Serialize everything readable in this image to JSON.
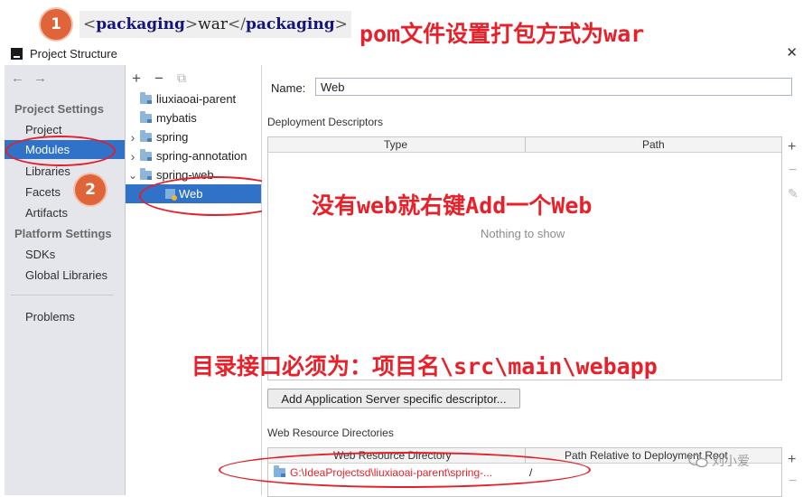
{
  "annotations": {
    "badge1": "1",
    "badge2": "2",
    "xml_open_tag": "packaging",
    "xml_value": "war",
    "xml_close_tag": "packaging",
    "note_pom": "pom文件设置打包方式为war",
    "note_add_web": "没有web就右键Add一个Web",
    "note_directory": "目录接口必须为：项目名\\src\\main\\webapp"
  },
  "window": {
    "title": "Project Structure",
    "close_glyph": "✕"
  },
  "left_nav": {
    "back_glyph": "←",
    "forward_glyph": "→",
    "project_settings_header": "Project Settings",
    "project_settings": [
      "Project",
      "Modules",
      "Libraries",
      "Facets",
      "Artifacts"
    ],
    "selected": "Modules",
    "platform_settings_header": "Platform Settings",
    "platform_settings": [
      "SDKs",
      "Global Libraries"
    ],
    "problems": "Problems"
  },
  "tree": {
    "toolbar": {
      "add": "+",
      "remove": "−",
      "copy": "⧉"
    },
    "items": [
      {
        "label": "liuxiaoai-parent",
        "expander": ""
      },
      {
        "label": "mybatis",
        "expander": ""
      },
      {
        "label": "spring",
        "expander": "›"
      },
      {
        "label": "spring-annotation",
        "expander": "›"
      },
      {
        "label": "spring-web",
        "expander": "⌄"
      },
      {
        "label": "Web",
        "expander": ""
      }
    ],
    "selected": "Web"
  },
  "detail": {
    "name_label": "Name:",
    "name_value": "Web",
    "deployment_label": "Deployment Descriptors",
    "deployment_columns": [
      "Type",
      "Path"
    ],
    "empty_text": "Nothing to show",
    "side_add": "+",
    "side_remove": "−",
    "side_edit": "✎",
    "add_server_button": "Add Application Server specific descriptor...",
    "web_resource_label": "Web Resource Directories",
    "web_resource_columns": [
      "Web Resource Directory",
      "Path Relative to Deployment Root"
    ],
    "web_resource_rows": [
      {
        "directory": "G:\\IdeaProjectsd\\liuxiaoai-parent\\spring-...",
        "path": "/"
      }
    ]
  },
  "watermark": "刘小爱",
  "colors": {
    "selection": "#2f72c8",
    "annotation_red": "#e8202a",
    "badge_orange": "#e0643a"
  }
}
